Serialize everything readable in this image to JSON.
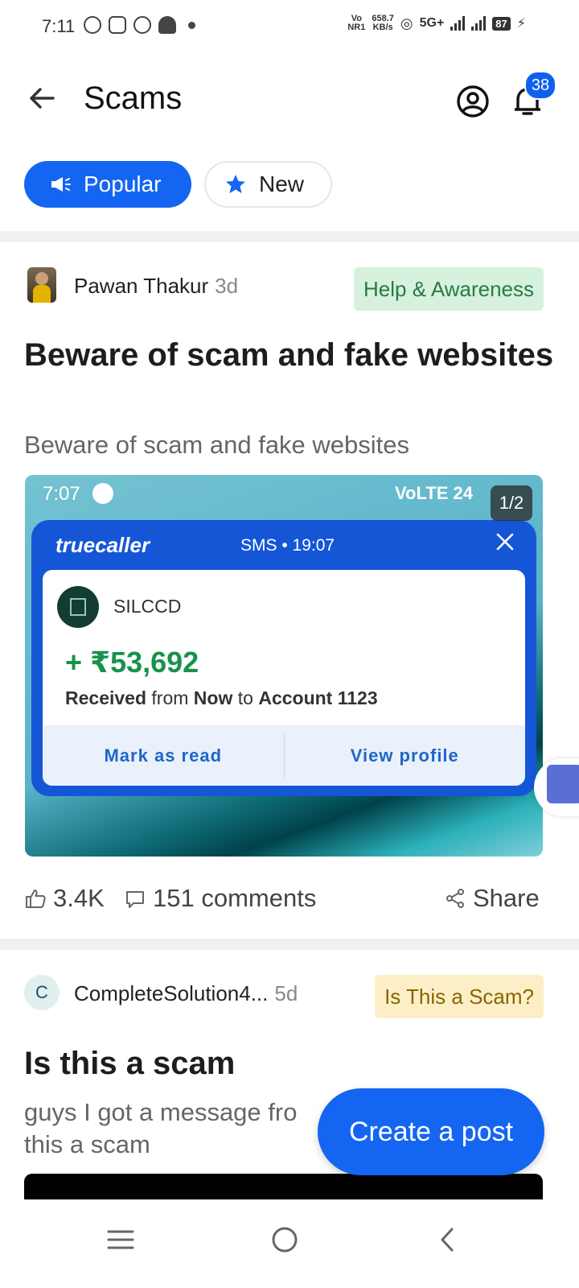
{
  "status_bar": {
    "time": "7:11",
    "net_top": "Vo",
    "net_bottom": "NR1",
    "speed_top": "658.7",
    "speed_bottom": "KB/s",
    "network": "5G+",
    "battery": "87"
  },
  "header": {
    "title": "Scams",
    "notification_count": "38"
  },
  "tabs": {
    "popular": "Popular",
    "new": "New"
  },
  "posts": [
    {
      "author": "Pawan Thakur",
      "age": "3d",
      "tag": "Help & Awareness",
      "title": "Beware of scam and fake websites",
      "body": "Beware of scam and fake websites",
      "image": {
        "time": "7:07",
        "status": "VoLTE  24",
        "counter": "1/2",
        "app": "truecaller",
        "sms_meta": "SMS • 19:07",
        "sender": "SILCCD",
        "amount": "+ ₹53,692",
        "msg_received": "Received",
        "msg_from": " from ",
        "msg_now": "Now",
        "msg_to": " to ",
        "msg_account": "Account 1123",
        "action_read": "Mark as read",
        "action_profile": "View profile"
      },
      "likes": "3.4K",
      "comments": "151 comments",
      "share": "Share"
    },
    {
      "author_initial": "C",
      "author": "CompleteSolution4...",
      "age": "5d",
      "tag": "Is This a Scam?",
      "title": "Is this a scam",
      "body": "guys I got a message fro this a scam"
    }
  ],
  "fab": {
    "label": "Create a post"
  },
  "colors": {
    "accent": "#1466f2",
    "tag_green_bg": "#d6f1de",
    "tag_yellow_bg": "#fcefc8",
    "truecaller_blue": "#1556d6",
    "amount_green": "#18924a"
  }
}
